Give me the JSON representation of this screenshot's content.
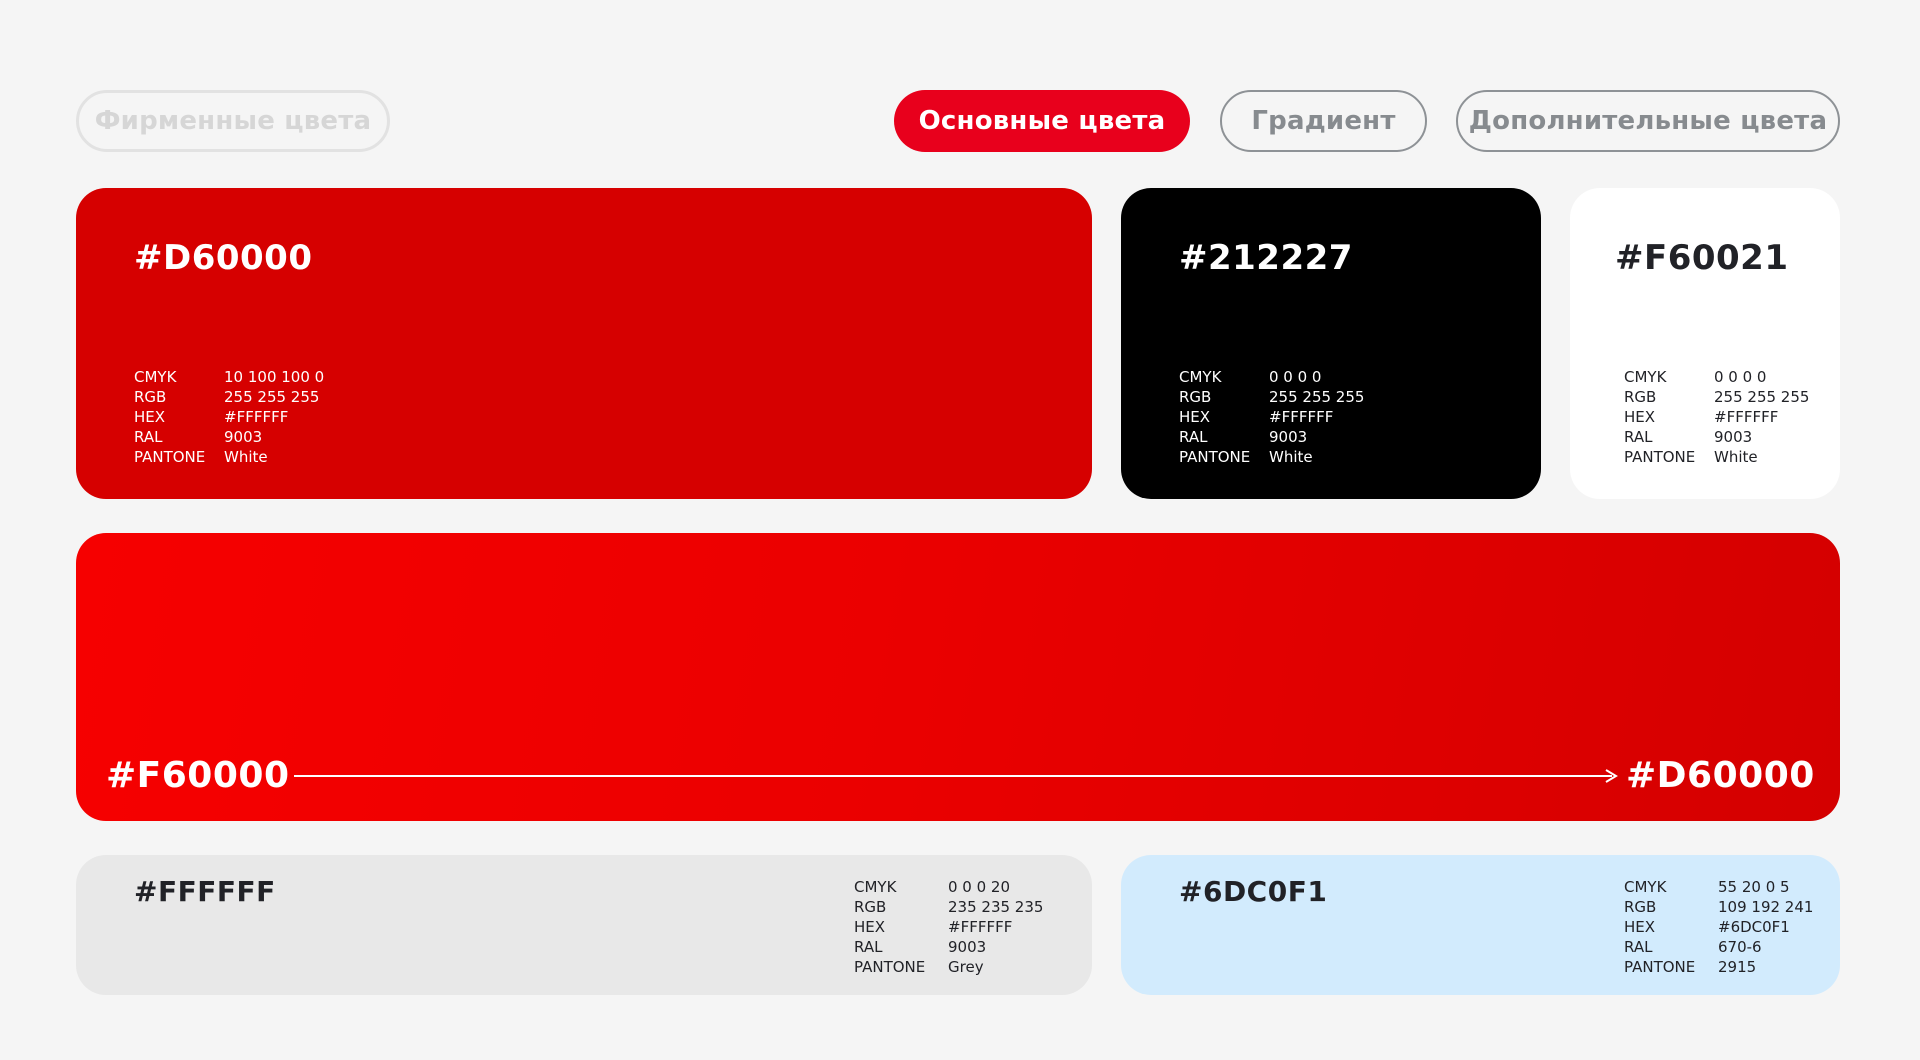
{
  "tabs": {
    "brand": "Фирменные цвета",
    "main": "Основные цвета",
    "gradient": "Градиент",
    "additional": "Дополнительные цвета"
  },
  "primary_cards": [
    {
      "hex": "#D60000",
      "bg": "#d60000",
      "fg": "#ffffff",
      "specs": {
        "cmyk": "10 100 100 0",
        "rgb": "255 255 255",
        "hex": "#FFFFFF",
        "ral": "9003",
        "pantone": "White"
      }
    },
    {
      "hex": "#212227",
      "bg": "#000000",
      "fg": "#ffffff",
      "specs": {
        "cmyk": "0 0 0 0",
        "rgb": "255 255 255",
        "hex": "#FFFFFF",
        "ral": "9003",
        "pantone": "White"
      }
    },
    {
      "hex": "#F60021",
      "bg": "#ffffff",
      "fg": "#212227",
      "specs": {
        "cmyk": "0 0 0 0",
        "rgb": "255 255 255",
        "hex": "#FFFFFF",
        "ral": "9003",
        "pantone": "White"
      }
    }
  ],
  "spec_labels": {
    "cmyk": "CMYK",
    "rgb": "RGB",
    "hex": "HEX",
    "ral": "RAL",
    "pantone": "PANTONE"
  },
  "gradient": {
    "start": "#F60000",
    "end": "#D60000"
  },
  "secondary_cards": [
    {
      "hex": "#FFFFFF",
      "bg": "#e8e8e8",
      "fg": "#212227",
      "specs": {
        "cmyk": "0 0 0 20",
        "rgb": "235 235 235",
        "hex": "#FFFFFF",
        "ral": "9003",
        "pantone": "Grey"
      }
    },
    {
      "hex": "#6DC0F1",
      "bg": "#d2ebfd",
      "fg": "#212227",
      "specs": {
        "cmyk": "55 20 0 5",
        "rgb": "109 192 241",
        "hex": "#6DC0F1",
        "ral": "670-6",
        "pantone": "2915"
      }
    }
  ]
}
